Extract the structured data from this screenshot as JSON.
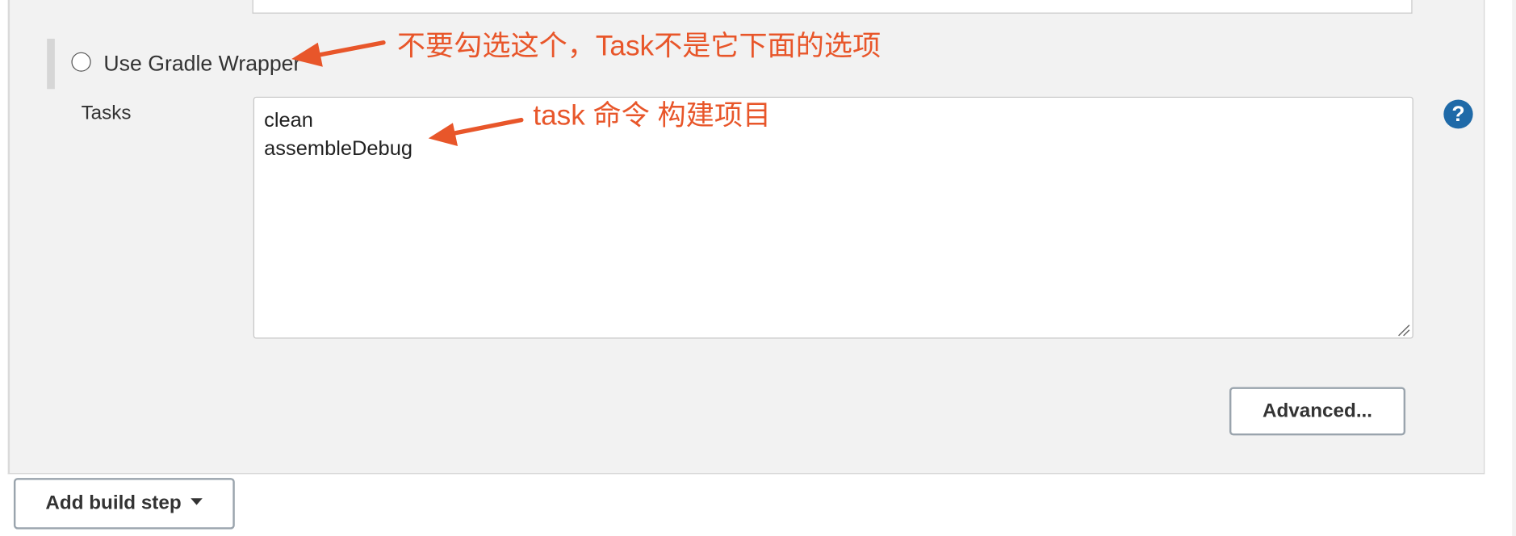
{
  "radio_option": {
    "label": "Use Gradle Wrapper"
  },
  "tasks_field": {
    "label": "Tasks",
    "value_lines": [
      "clean",
      "assembleDebug"
    ]
  },
  "buttons": {
    "advanced": "Advanced...",
    "add_build_step": "Add build step"
  },
  "help": {
    "glyph": "?"
  },
  "annotations": {
    "wrapper_note": "不要勾选这个，Task不是它下面的选项",
    "task_note": "task 命令 构建项目"
  },
  "colors": {
    "annotation": "#e8562a",
    "help_icon": "#1f6aa8"
  }
}
